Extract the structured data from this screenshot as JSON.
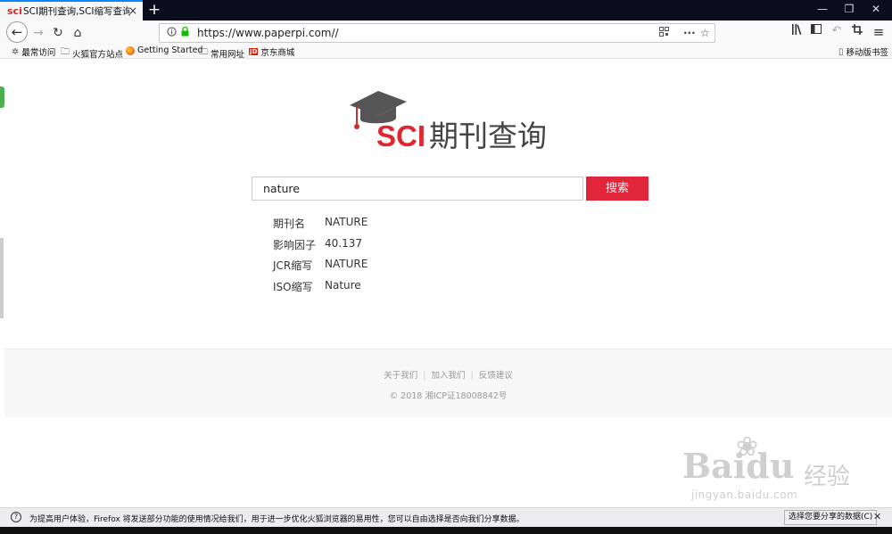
{
  "browser": {
    "tab": {
      "favicon": "sci",
      "title": "SCI期刊查询,SCI缩写查询,SCI-",
      "close_icon": "×"
    },
    "new_tab_icon": "+",
    "window_controls": {
      "minimize": "—",
      "restore": "❐",
      "close": "✕"
    },
    "nav": {
      "back": "←",
      "forward": "→",
      "reload": "↻",
      "home": "⌂"
    },
    "url": "https://www.paperpi.com//",
    "url_icons": [
      "info-icon",
      "lock-icon",
      "qr-icon",
      "more-icon",
      "star-icon"
    ],
    "toolbar_right_icons": [
      "library-icon",
      "sidebar-icon",
      "undo-icon",
      "crop-icon",
      "menu-icon"
    ],
    "bookmarks": [
      {
        "label": "最常访问",
        "icon": "gear-icon"
      },
      {
        "label": "火狐官方站点",
        "icon": "folder-icon"
      },
      {
        "label": "Getting Started",
        "icon": "firefox-icon"
      },
      {
        "label": "常用网址",
        "icon": "folder-icon"
      },
      {
        "label": "京东商城",
        "icon": "jd-icon",
        "badge": "JD"
      }
    ],
    "mobile_bookmarks": "移动版书签"
  },
  "site": {
    "logo": {
      "sci": "SCI",
      "title": "期刊查询"
    },
    "search": {
      "value": "nature",
      "button": "搜索"
    },
    "results": [
      {
        "label": "期刊名",
        "value": "NATURE"
      },
      {
        "label": "影响因子",
        "value": "40.137"
      },
      {
        "label": "JCR缩写",
        "value": "NATURE"
      },
      {
        "label": "ISO缩写",
        "value": "Nature"
      }
    ],
    "footer": {
      "links": [
        "关于我们",
        "加入我们",
        "反馈建议"
      ],
      "copyright": "© 2018 湘ICP证18008842号"
    }
  },
  "watermark": {
    "brand": "Baidu",
    "cn": "经验",
    "url": "jingyan.baidu.com"
  },
  "notification": {
    "text": "为提高用户体验，Firefox 将发送部分功能的使用情况给我们，用于进一步优化火狐浏览器的易用性，您可以自由选择是否向我们分享数据。",
    "button": "选择您要分享的数据(C)",
    "close": "✕"
  },
  "colors": {
    "accent": "#e0263a",
    "tab_highlight": "#0a84ff",
    "secure": "#12bc00"
  }
}
